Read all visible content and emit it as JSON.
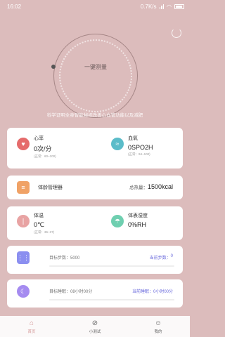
{
  "status_bar": {
    "time": "16:02",
    "net_speed": "0.7K/s"
  },
  "hero": {
    "measure_label": "一键测量",
    "tagline": "科学证明全身智能秘视改善心血管功能以及减肥"
  },
  "vitals_card": {
    "heart_rate": {
      "name": "心率",
      "value": "0次/分",
      "normal": "(正常：60~100)"
    },
    "blood_oxygen": {
      "name": "血氧",
      "value": "0SPO2H",
      "normal": "(正常：94~100)"
    }
  },
  "weight_card": {
    "title": "体龄管理器",
    "total_label": "总热量：",
    "total_value": "1500kcal"
  },
  "env_card": {
    "temperature": {
      "name": "体温",
      "value": "0℃",
      "normal": "(正常：36~37)"
    },
    "humidity": {
      "name": "体表湿度",
      "value": "0%RH"
    }
  },
  "steps_card": {
    "target": "目标步数：5000",
    "current_label": "当前步数：",
    "current_value": "0",
    "progress": 0
  },
  "sleep_card": {
    "target": "目标睡眠：08小时00分",
    "current_label": "当前睡眠：",
    "current_value": "0小时00分",
    "progress": 0
  },
  "tabs": [
    {
      "label": "首页",
      "icon": "home-icon"
    },
    {
      "label": "小测试",
      "icon": "compass-icon"
    },
    {
      "label": "我的",
      "icon": "user-icon"
    }
  ],
  "colors": {
    "background": "#dcbcbc",
    "heart": "#e56b6b",
    "oxygen": "#5bbcc9",
    "weight": "#f0a266",
    "temp": "#e8a3a3",
    "humidity": "#6fcfb0",
    "steps": "#8b8ff0",
    "sleep": "#a58bf0"
  }
}
